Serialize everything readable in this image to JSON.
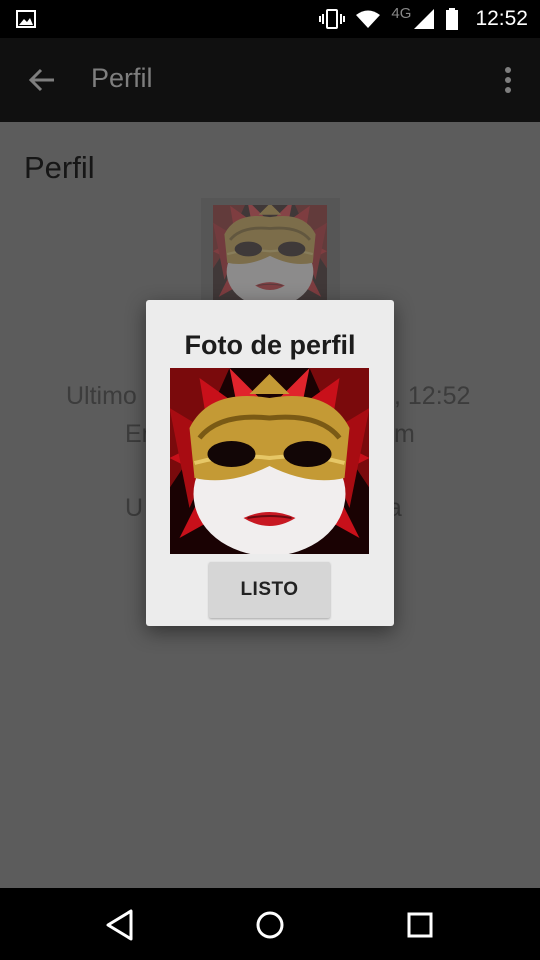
{
  "status_bar": {
    "time": "12:52",
    "network": "4G",
    "icons": [
      "gallery-icon",
      "vibrate-icon",
      "wifi-icon",
      "signal-icon",
      "battery-icon"
    ]
  },
  "app_bar": {
    "title": "Perfil",
    "back_icon": "arrow-back-icon",
    "menu_icon": "more-vert-icon"
  },
  "page": {
    "heading": "Perfil",
    "line1_left": "Ultimo",
    "line1_right": ", 12:52",
    "line2_left": "En",
    "line2_right": "m",
    "line3_left": "U",
    "line3_right": "da"
  },
  "dialog": {
    "title": "Foto de perfil",
    "button_label": "LISTO"
  },
  "nav_bar": {
    "icons": [
      "back-triangle-icon",
      "home-circle-icon",
      "recents-square-icon"
    ]
  },
  "colors": {
    "scrim": "#5c5c5c",
    "dialog_bg": "#ececec",
    "button_bg": "#d6d6d6",
    "mask_red": "#c8101a",
    "mask_gold": "#c49a35"
  }
}
